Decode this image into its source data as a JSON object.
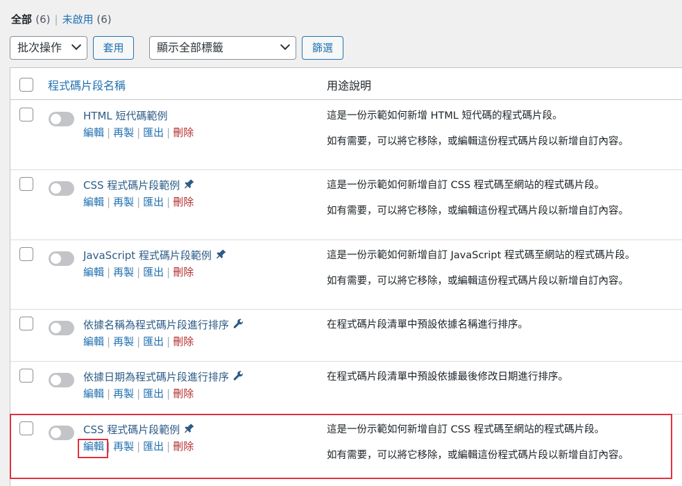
{
  "filters": {
    "all_label": "全部",
    "all_count": "(6)",
    "separator": "|",
    "inactive_label": "未啟用",
    "inactive_count": "(6)"
  },
  "toolbar": {
    "bulk_select": "批次操作",
    "apply_button": "套用",
    "tag_select": "顯示全部標籤",
    "filter_button": "篩選"
  },
  "table": {
    "col_name": "程式碼片段名稱",
    "col_desc": "用途說明",
    "actions": {
      "edit": "編輯",
      "clone": "再製",
      "export": "匯出",
      "delete": "刪除",
      "pipe": "|"
    },
    "rows": [
      {
        "name": "HTML 短代碼範例",
        "icon": "",
        "desc1": "這是一份示範如何新增 HTML 短代碼的程式碼片段。",
        "desc2": "如有需要，可以將它移除，或編輯這份程式碼片段以新增自訂內容。"
      },
      {
        "name": "CSS 程式碼片段範例",
        "icon": "pin-icon",
        "desc1": "這是一份示範如何新增自訂 CSS 程式碼至網站的程式碼片段。",
        "desc2": "如有需要，可以將它移除，或編輯這份程式碼片段以新增自訂內容。"
      },
      {
        "name": "JavaScript 程式碼片段範例",
        "icon": "pin-icon",
        "desc1": "這是一份示範如何新增自訂 JavaScript 程式碼至網站的程式碼片段。",
        "desc2": "如有需要，可以將它移除，或編輯這份程式碼片段以新增自訂內容。"
      },
      {
        "name": "依據名稱為程式碼片段進行排序",
        "icon": "wrench-icon",
        "desc1": "在程式碼片段清單中預設依據名稱進行排序。",
        "desc2": ""
      },
      {
        "name": "依據日期為程式碼片段進行排序",
        "icon": "wrench-icon",
        "desc1": "在程式碼片段清單中預設依據最後修改日期進行排序。",
        "desc2": ""
      },
      {
        "name": "CSS 程式碼片段範例",
        "icon": "pin-icon",
        "desc1": "這是一份示範如何新增自訂 CSS 程式碼至網站的程式碼片段。",
        "desc2": "如有需要，可以將它移除，或編輯這份程式碼片段以新增自訂內容。"
      }
    ]
  },
  "colors": {
    "link": "#2271b1",
    "delete": "#b32d2e",
    "highlight": "#e0303c"
  }
}
